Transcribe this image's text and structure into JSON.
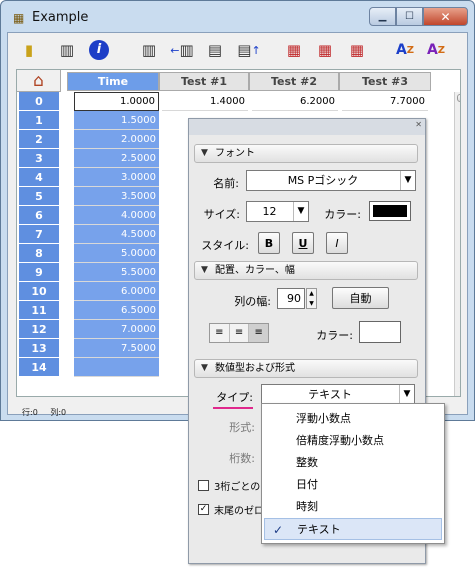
{
  "window": {
    "title": "Example",
    "app_icon": "spreadsheet-icon",
    "minimize_icon": "minimize-icon",
    "maximize_icon": "maximize-icon",
    "close_icon": "close-icon"
  },
  "toolbar": {
    "icons": [
      "note-icon",
      "insert-column-icon",
      "info-icon",
      "columns-icon",
      "insert-column-left-icon",
      "insert-row-icon",
      "insert-row-right-icon",
      "table-red-icon",
      "table-red-copy-icon",
      "table-red-edit-icon",
      "sort-az-icon",
      "sort-za-icon"
    ]
  },
  "grid": {
    "home_icon": "home-icon",
    "columns": [
      "Time",
      "Test #1",
      "Test #2",
      "Test #3"
    ],
    "rows": [
      {
        "label": "0",
        "time": "1.0000",
        "t1": "1.4000",
        "t2": "6.2000",
        "t3": "7.7000"
      },
      {
        "label": "1",
        "time": "1.5000"
      },
      {
        "label": "2",
        "time": "2.0000"
      },
      {
        "label": "3",
        "time": "2.5000"
      },
      {
        "label": "4",
        "time": "3.0000"
      },
      {
        "label": "5",
        "time": "3.5000"
      },
      {
        "label": "6",
        "time": "4.0000"
      },
      {
        "label": "7",
        "time": "4.5000"
      },
      {
        "label": "8",
        "time": "5.0000"
      },
      {
        "label": "9",
        "time": "5.5000"
      },
      {
        "label": "10",
        "time": "6.0000"
      },
      {
        "label": "11",
        "time": "6.5000"
      },
      {
        "label": "12",
        "time": "7.0000"
      },
      {
        "label": "13",
        "time": "7.5000"
      },
      {
        "label": "14",
        "time": ""
      }
    ]
  },
  "status": {
    "row": "行:0",
    "col": "列:0"
  },
  "panel": {
    "font_section": "フォント",
    "name_label": "名前:",
    "font_name": "MS Pゴシック",
    "size_label": "サイズ:",
    "size_value": "12",
    "color_label": "カラー:",
    "font_color": "#000000",
    "style_label": "スタイル:",
    "bold": "B",
    "underline": "U",
    "italic": "I",
    "layout_section": "配置、カラー、幅",
    "width_label": "列の幅:",
    "width_value": "90",
    "auto_button": "自動",
    "align_icons": [
      "align-left-icon",
      "align-center-icon",
      "align-right-icon"
    ],
    "bg_color_label": "カラー:",
    "bg_color": "#ffffff",
    "numtype_section": "数値型および形式",
    "type_label": "タイプ:",
    "type_value": "テキスト",
    "format_label": "形式:",
    "digits_label": "桁数:",
    "thousands_label": "3桁ごとの",
    "trailing_zero_label": "末尾のゼロ"
  },
  "dropdown": {
    "options": [
      "浮動小数点",
      "倍精度浮動小数点",
      "整数",
      "日付",
      "時刻",
      "テキスト"
    ],
    "selected": "テキスト"
  }
}
